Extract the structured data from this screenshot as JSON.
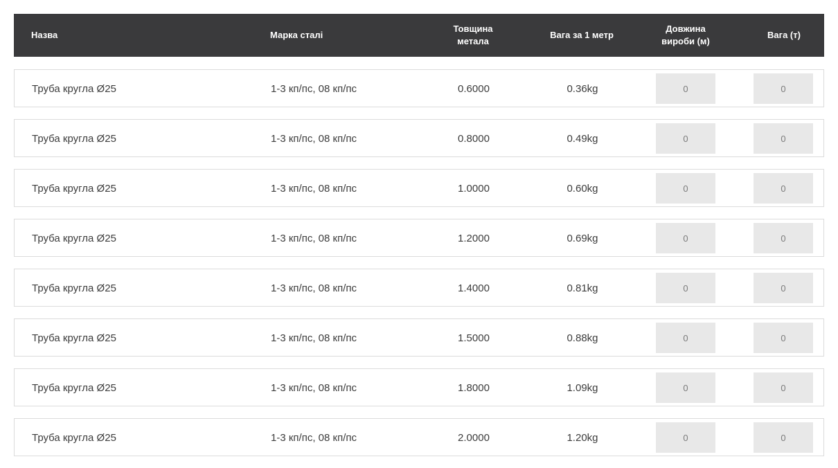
{
  "header": {
    "name": "Назва",
    "grade": "Марка сталі",
    "thickness_line1": "Товщина",
    "thickness_line2": "метала",
    "weight_per_meter": "Вага за 1 метр",
    "length_line1": "Довжина",
    "length_line2": "вироби (м)",
    "weight_tons": "Вага (т)"
  },
  "rows": [
    {
      "name": "Труба кругла Ø25",
      "grade": "1-3 кп/пс, 08 кп/пс",
      "thickness": "0.6000",
      "weight": "0.36kg",
      "length": "0",
      "tons": "0"
    },
    {
      "name": "Труба кругла Ø25",
      "grade": "1-3 кп/пс, 08 кп/пс",
      "thickness": "0.8000",
      "weight": "0.49kg",
      "length": "0",
      "tons": "0"
    },
    {
      "name": "Труба кругла Ø25",
      "grade": "1-3 кп/пс, 08 кп/пс",
      "thickness": "1.0000",
      "weight": "0.60kg",
      "length": "0",
      "tons": "0"
    },
    {
      "name": "Труба кругла Ø25",
      "grade": "1-3 кп/пс, 08 кп/пс",
      "thickness": "1.2000",
      "weight": "0.69kg",
      "length": "0",
      "tons": "0"
    },
    {
      "name": "Труба кругла Ø25",
      "grade": "1-3 кп/пс, 08 кп/пс",
      "thickness": "1.4000",
      "weight": "0.81kg",
      "length": "0",
      "tons": "0"
    },
    {
      "name": "Труба кругла Ø25",
      "grade": "1-3 кп/пс, 08 кп/пс",
      "thickness": "1.5000",
      "weight": "0.88kg",
      "length": "0",
      "tons": "0"
    },
    {
      "name": "Труба кругла Ø25",
      "grade": "1-3 кп/пс, 08 кп/пс",
      "thickness": "1.8000",
      "weight": "1.09kg",
      "length": "0",
      "tons": "0"
    },
    {
      "name": "Труба кругла Ø25",
      "grade": "1-3 кп/пс, 08 кп/пс",
      "thickness": "2.0000",
      "weight": "1.20kg",
      "length": "0",
      "tons": "0"
    }
  ],
  "colors": {
    "header_bg": "#3a3a3c",
    "header_text": "#ffffff",
    "row_border": "#dcdcdc",
    "input_bg": "#e8e8e8"
  }
}
